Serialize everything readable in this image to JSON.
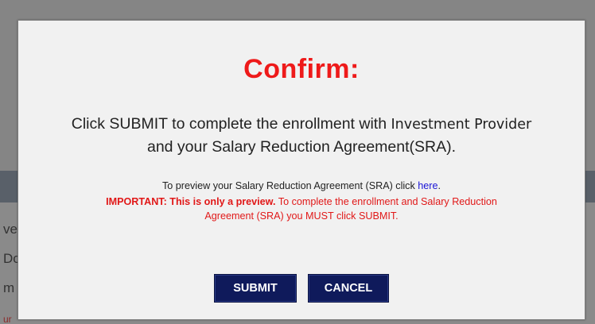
{
  "background": {
    "fragments": [
      "ve",
      "Do",
      "m",
      "ur"
    ]
  },
  "dialog": {
    "title": "Confirm:",
    "message_part1": "Click SUBMIT to complete the enrollment with ",
    "provider": "Investment Provider",
    "message_part2": "and your Salary Reduction Agreement(SRA).",
    "preview_text": "To preview your Salary Reduction Agreement (SRA) click ",
    "preview_link": "here",
    "preview_end": ".",
    "important_bold": "IMPORTANT: This is only a preview.",
    "important_text": " To complete the enrollment and Salary Reduction",
    "important_line2": "Agreement (SRA) you MUST click SUBMIT.",
    "submit_label": "SUBMIT",
    "cancel_label": "CANCEL"
  },
  "colors": {
    "title": "#ee1a1a",
    "important": "#e11818",
    "link": "#1a14d6",
    "button_bg": "#0f1a5b",
    "overlay": "#858585"
  }
}
